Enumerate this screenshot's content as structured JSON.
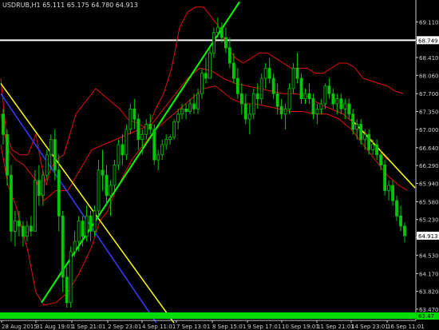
{
  "chart_data": {
    "type": "candlestick",
    "title": "USDRUB,H1  65.111 65.175 64.780 64.913",
    "symbol": "USDRUB,H1",
    "current_price_label": "64.913",
    "ylim": [
      63.25,
      69.35
    ],
    "y_ticks": [
      "69.110",
      "68.749",
      "68.410",
      "68.060",
      "67.700",
      "67.350",
      "67.000",
      "66.640",
      "66.290",
      "65.940",
      "65.580",
      "65.230",
      "64.880",
      "64.530",
      "64.170",
      "63.820",
      "63.470"
    ],
    "x_ticks": [
      "28 Aug 2015",
      "31 Aug 19:01",
      "1 Sep 21:01",
      "2 Sep 23:01",
      "4 Sep 11:01",
      "7 Sep 13:01",
      "8 Sep 15:01",
      "9 Sep 17:01",
      "10 Sep 19:01",
      "11 Sep 21:01",
      "14 Sep 23:01",
      "16 Sep 11:01"
    ],
    "horizontal_line": {
      "value": 68.749,
      "label": "68.749"
    },
    "bottom_label": "63.47",
    "colors": {
      "background": "#000000",
      "candle": "#00c800",
      "axis": "#c8c8c8",
      "bands": "#e01010",
      "hline": "#ffffff",
      "price_box": "#ffffff",
      "bottom_bar": "#00dc00"
    },
    "bands": {
      "upper": [
        [
          1,
          68.0
        ],
        [
          8,
          66.9
        ],
        [
          15,
          66.6
        ],
        [
          25,
          66.5
        ],
        [
          35,
          66.5
        ],
        [
          45,
          66.9
        ],
        [
          52,
          66.3
        ],
        [
          58,
          65.9
        ],
        [
          63,
          66.2
        ],
        [
          70,
          66.4
        ],
        [
          80,
          66.5
        ],
        [
          95,
          67.3
        ],
        [
          105,
          67.5
        ],
        [
          120,
          67.8
        ],
        [
          135,
          67.6
        ],
        [
          150,
          67.4
        ],
        [
          160,
          67.2
        ],
        [
          175,
          67.1
        ],
        [
          185,
          67.0
        ],
        [
          195,
          67.4
        ],
        [
          205,
          67.7
        ],
        [
          215,
          68.2
        ],
        [
          225,
          69.0
        ],
        [
          235,
          69.3
        ],
        [
          245,
          69.4
        ],
        [
          255,
          69.4
        ],
        [
          265,
          69.2
        ],
        [
          275,
          69.0
        ],
        [
          285,
          68.6
        ],
        [
          295,
          68.4
        ],
        [
          305,
          68.3
        ],
        [
          315,
          68.4
        ],
        [
          325,
          68.5
        ],
        [
          335,
          68.5
        ],
        [
          345,
          68.4
        ],
        [
          355,
          68.3
        ],
        [
          365,
          68.2
        ],
        [
          375,
          68.2
        ],
        [
          385,
          68.2
        ],
        [
          395,
          68.1
        ],
        [
          405,
          68.1
        ],
        [
          415,
          68.2
        ],
        [
          425,
          68.3
        ],
        [
          435,
          68.3
        ],
        [
          445,
          68.2
        ],
        [
          455,
          68.0
        ],
        [
          465,
          67.95
        ],
        [
          475,
          67.9
        ],
        [
          485,
          67.85
        ],
        [
          495,
          67.75
        ],
        [
          505,
          67.7
        ]
      ],
      "middle": [
        [
          1,
          67.3
        ],
        [
          10,
          66.6
        ],
        [
          20,
          66.4
        ],
        [
          30,
          66.3
        ],
        [
          45,
          66.0
        ],
        [
          55,
          65.6
        ],
        [
          70,
          65.8
        ],
        [
          85,
          65.8
        ],
        [
          100,
          66.2
        ],
        [
          115,
          66.6
        ],
        [
          130,
          66.7
        ],
        [
          145,
          66.8
        ],
        [
          160,
          66.9
        ],
        [
          175,
          67.0
        ],
        [
          190,
          67.1
        ],
        [
          205,
          67.4
        ],
        [
          220,
          67.7
        ],
        [
          235,
          68.0
        ],
        [
          250,
          68.2
        ],
        [
          265,
          68.15
        ],
        [
          280,
          68.0
        ],
        [
          295,
          67.9
        ],
        [
          310,
          67.85
        ],
        [
          325,
          67.8
        ],
        [
          340,
          67.75
        ],
        [
          355,
          67.7
        ],
        [
          370,
          67.7
        ],
        [
          385,
          67.65
        ],
        [
          400,
          67.5
        ],
        [
          415,
          67.4
        ],
        [
          430,
          67.3
        ],
        [
          445,
          67.1
        ],
        [
          460,
          66.9
        ],
        [
          475,
          66.6
        ],
        [
          485,
          66.4
        ]
      ],
      "lower": [
        [
          1,
          66.7
        ],
        [
          10,
          65.9
        ],
        [
          20,
          65.5
        ],
        [
          35,
          64.6
        ],
        [
          45,
          63.8
        ],
        [
          55,
          63.55
        ],
        [
          70,
          63.6
        ],
        [
          85,
          63.8
        ],
        [
          100,
          64.2
        ],
        [
          115,
          64.7
        ],
        [
          125,
          65.2
        ],
        [
          135,
          65.4
        ],
        [
          145,
          65.8
        ],
        [
          155,
          66.1
        ],
        [
          165,
          66.4
        ],
        [
          175,
          66.6
        ],
        [
          185,
          66.8
        ],
        [
          195,
          67.0
        ],
        [
          210,
          67.2
        ],
        [
          225,
          67.4
        ],
        [
          240,
          67.6
        ],
        [
          255,
          67.8
        ],
        [
          270,
          67.85
        ],
        [
          290,
          67.6
        ],
        [
          305,
          67.5
        ],
        [
          320,
          67.5
        ],
        [
          335,
          67.45
        ],
        [
          350,
          67.4
        ],
        [
          365,
          67.35
        ],
        [
          380,
          67.35
        ],
        [
          395,
          67.3
        ],
        [
          410,
          67.3
        ],
        [
          425,
          67.2
        ],
        [
          440,
          67.0
        ],
        [
          455,
          66.7
        ],
        [
          470,
          66.4
        ],
        [
          485,
          66.1
        ],
        [
          500,
          65.9
        ],
        [
          510,
          65.8
        ]
      ]
    },
    "trend_lines": [
      {
        "color": "#ffff00",
        "from": [
          1,
          67.9
        ],
        "to": [
          218,
          63.2
        ]
      },
      {
        "color": "#3a3aff",
        "from": [
          1,
          67.7
        ],
        "to": [
          196,
          63.2
        ]
      },
      {
        "color": "#00ff00",
        "from": [
          52,
          63.6
        ],
        "to": [
          300,
          69.5
        ]
      },
      {
        "color": "#ffff00",
        "from": [
          440,
          67.2
        ],
        "to": [
          520,
          65.85
        ]
      }
    ],
    "candles": [
      [
        67.3,
        67.4,
        66.7,
        66.9
      ],
      [
        66.9,
        67.0,
        65.9,
        66.1
      ],
      [
        66.1,
        66.3,
        64.8,
        65.0
      ],
      [
        65.0,
        65.4,
        64.7,
        65.2
      ],
      [
        65.2,
        65.4,
        64.9,
        65.1
      ],
      [
        65.1,
        65.2,
        64.7,
        64.9
      ],
      [
        64.9,
        65.2,
        64.8,
        65.1
      ],
      [
        65.1,
        65.3,
        64.9,
        65.0
      ],
      [
        65.0,
        66.2,
        65.0,
        66.0
      ],
      [
        66.0,
        66.3,
        65.5,
        65.7
      ],
      [
        65.7,
        66.2,
        65.5,
        66.1
      ],
      [
        66.1,
        66.6,
        66.0,
        66.5
      ],
      [
        66.5,
        66.9,
        66.2,
        66.8
      ],
      [
        66.8,
        67.0,
        66.0,
        66.2
      ],
      [
        66.2,
        66.5,
        65.0,
        65.3
      ],
      [
        65.3,
        65.4,
        63.8,
        64.1
      ],
      [
        64.1,
        64.3,
        63.5,
        63.6
      ],
      [
        63.6,
        64.7,
        63.5,
        64.6
      ],
      [
        64.6,
        65.0,
        64.5,
        64.8
      ],
      [
        64.8,
        65.3,
        64.6,
        65.2
      ],
      [
        65.2,
        65.3,
        64.7,
        64.9
      ],
      [
        64.9,
        65.5,
        64.8,
        65.3
      ],
      [
        65.3,
        65.4,
        64.8,
        65.0
      ],
      [
        65.0,
        65.5,
        64.9,
        65.4
      ],
      [
        65.4,
        66.4,
        65.3,
        66.2
      ],
      [
        66.2,
        66.6,
        65.8,
        66.1
      ],
      [
        66.1,
        66.3,
        65.5,
        65.7
      ],
      [
        65.7,
        66.0,
        65.3,
        65.9
      ],
      [
        65.9,
        66.4,
        65.8,
        66.3
      ],
      [
        66.3,
        66.8,
        66.2,
        66.7
      ],
      [
        66.7,
        66.9,
        66.3,
        66.5
      ],
      [
        66.5,
        67.1,
        66.4,
        67.0
      ],
      [
        67.0,
        67.5,
        66.9,
        67.4
      ],
      [
        67.4,
        67.6,
        67.0,
        67.2
      ],
      [
        67.2,
        67.3,
        66.6,
        66.8
      ],
      [
        66.8,
        67.0,
        66.5,
        66.9
      ],
      [
        66.9,
        67.2,
        66.8,
        67.1
      ],
      [
        67.1,
        67.3,
        66.9,
        67.0
      ],
      [
        67.0,
        67.1,
        66.3,
        66.4
      ],
      [
        66.4,
        66.6,
        66.2,
        66.5
      ],
      [
        66.5,
        66.8,
        66.4,
        66.7
      ],
      [
        66.7,
        66.9,
        66.6,
        66.8
      ],
      [
        66.8,
        66.9,
        66.7,
        66.85
      ],
      [
        66.85,
        67.2,
        66.8,
        67.15
      ],
      [
        67.15,
        67.4,
        67.0,
        67.3
      ],
      [
        67.3,
        67.5,
        67.2,
        67.4
      ],
      [
        67.4,
        67.5,
        67.2,
        67.35
      ],
      [
        67.35,
        67.6,
        67.3,
        67.5
      ],
      [
        67.5,
        67.7,
        67.3,
        67.4
      ],
      [
        67.4,
        67.8,
        67.3,
        67.7
      ],
      [
        67.7,
        68.2,
        67.6,
        68.1
      ],
      [
        68.1,
        68.4,
        67.9,
        68.0
      ],
      [
        68.0,
        68.6,
        68.0,
        68.5
      ],
      [
        68.5,
        69.0,
        68.4,
        68.9
      ],
      [
        68.9,
        69.2,
        68.8,
        69.0
      ],
      [
        69.0,
        69.1,
        68.7,
        68.8
      ],
      [
        68.8,
        69.0,
        68.5,
        68.6
      ],
      [
        68.6,
        68.8,
        68.2,
        68.3
      ],
      [
        68.3,
        68.5,
        67.9,
        68.0
      ],
      [
        68.0,
        68.2,
        67.6,
        67.7
      ],
      [
        67.7,
        67.9,
        67.3,
        67.5
      ],
      [
        67.5,
        67.7,
        67.1,
        67.2
      ],
      [
        67.2,
        67.5,
        66.9,
        67.3
      ],
      [
        67.3,
        67.8,
        67.2,
        67.7
      ],
      [
        67.7,
        67.9,
        67.4,
        67.6
      ],
      [
        67.6,
        68.1,
        67.5,
        68.0
      ],
      [
        68.0,
        68.3,
        67.8,
        68.2
      ],
      [
        68.2,
        68.4,
        67.9,
        68.0
      ],
      [
        68.0,
        68.1,
        67.6,
        67.7
      ],
      [
        67.7,
        67.9,
        67.3,
        67.45
      ],
      [
        67.45,
        67.6,
        67.2,
        67.3
      ],
      [
        67.3,
        67.5,
        67.0,
        67.4
      ],
      [
        67.4,
        67.9,
        67.3,
        67.8
      ],
      [
        67.8,
        68.3,
        67.7,
        68.2
      ],
      [
        68.2,
        68.5,
        67.9,
        68.0
      ],
      [
        68.0,
        68.1,
        67.5,
        67.6
      ],
      [
        67.6,
        67.8,
        67.5,
        67.7
      ],
      [
        67.7,
        67.9,
        67.5,
        67.6
      ],
      [
        67.6,
        67.7,
        67.2,
        67.3
      ],
      [
        67.3,
        67.5,
        67.1,
        67.4
      ],
      [
        67.4,
        67.6,
        67.3,
        67.5
      ],
      [
        67.5,
        67.9,
        67.4,
        67.85
      ],
      [
        67.85,
        68.0,
        67.6,
        67.7
      ],
      [
        67.7,
        67.8,
        67.4,
        67.5
      ],
      [
        67.5,
        67.7,
        67.3,
        67.6
      ],
      [
        67.6,
        67.7,
        67.3,
        67.4
      ],
      [
        67.4,
        67.6,
        67.2,
        67.5
      ],
      [
        67.5,
        67.6,
        67.2,
        67.3
      ],
      [
        67.3,
        67.4,
        66.9,
        67.0
      ],
      [
        67.0,
        67.2,
        66.8,
        67.1
      ],
      [
        67.1,
        67.2,
        66.7,
        66.8
      ],
      [
        66.8,
        67.0,
        66.6,
        66.9
      ],
      [
        66.9,
        67.0,
        66.5,
        66.6
      ],
      [
        66.6,
        66.8,
        66.5,
        66.7
      ],
      [
        66.7,
        66.8,
        66.4,
        66.5
      ],
      [
        66.5,
        66.6,
        66.2,
        66.3
      ],
      [
        66.3,
        66.4,
        65.7,
        65.8
      ],
      [
        65.8,
        66.0,
        65.6,
        65.9
      ],
      [
        65.9,
        66.0,
        65.5,
        65.6
      ],
      [
        65.6,
        65.7,
        65.2,
        65.3
      ],
      [
        65.3,
        65.5,
        65.0,
        65.1
      ],
      [
        65.1,
        65.175,
        64.78,
        64.913
      ]
    ]
  }
}
